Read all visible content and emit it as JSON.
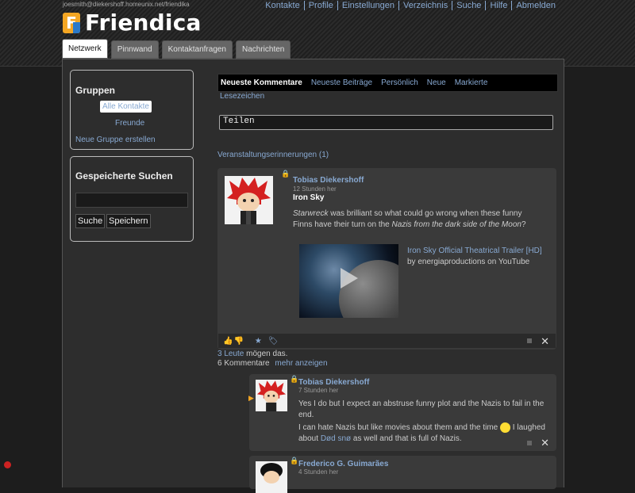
{
  "header": {
    "user_address": "joesmith@diekershoff.homeunix.net/friendika",
    "logo_letter": "F",
    "logo_text": "Friendica",
    "nav": [
      "Kontakte",
      "Profile",
      "Einstellungen",
      "Verzeichnis",
      "Suche",
      "Hilfe",
      "Abmelden"
    ]
  },
  "tabs": [
    "Netzwerk",
    "Pinnwand",
    "Kontaktanfragen",
    "Nachrichten"
  ],
  "active_tab": "Netzwerk",
  "sidebar": {
    "groups": {
      "title": "Gruppen",
      "items": [
        "Alle Kontakte",
        "Freunde"
      ],
      "create": "Neue Gruppe erstellen"
    },
    "saved_searches": {
      "title": "Gespeicherte Suchen",
      "search_value": "",
      "search_button": "Suche",
      "save_button": "Speichern"
    }
  },
  "network": {
    "subtabs": [
      "Neueste Kommentare",
      "Neueste Beiträge",
      "Persönlich",
      "Neue",
      "Markierte"
    ],
    "subtab_second_row": "Lesezeichen",
    "share_placeholder": "Teilen",
    "events": "Veranstaltungserinnerungen (1)"
  },
  "post": {
    "author": "Tobias Diekershoff",
    "time": "12 Stunden her",
    "title": "Iron Sky",
    "body_part1": "Starwreck",
    "body_part2": " was brilliant so what could go wrong when these funny Finns have their turn on the ",
    "body_part3": "Nazis from the dark side of the Moon",
    "body_part4": "?",
    "video_link": "Iron Sky Official Theatrical Trailer [HD]",
    "video_by": " by energiaproductions on YouTube",
    "likes_count": "3 Leute",
    "likes_text": " mögen das.",
    "comments_count": "6 Kommentare",
    "show_more": "mehr anzeigen"
  },
  "comments": [
    {
      "author": "Tobias Diekershoff",
      "time": "7 Stunden her",
      "text1": "Yes I do but I expect an abstruse funny plot and the Nazis to fail in the end.",
      "text2a": "I can hate Nazis but like movies about them and the time ",
      "text2b": " I laughed about ",
      "link": "Død snø",
      "text2c": " as well and that is full of Nazis."
    },
    {
      "author": "Frederico G. Guimarães",
      "time": "4 Stunden her"
    }
  ],
  "colors": {
    "link": "#88a9d2",
    "background": "#1d1d1d",
    "panel": "#2d2d2d",
    "item": "#3a3a3a",
    "logo_orange": "#f4a623",
    "logo_blue": "#2a79c9"
  }
}
